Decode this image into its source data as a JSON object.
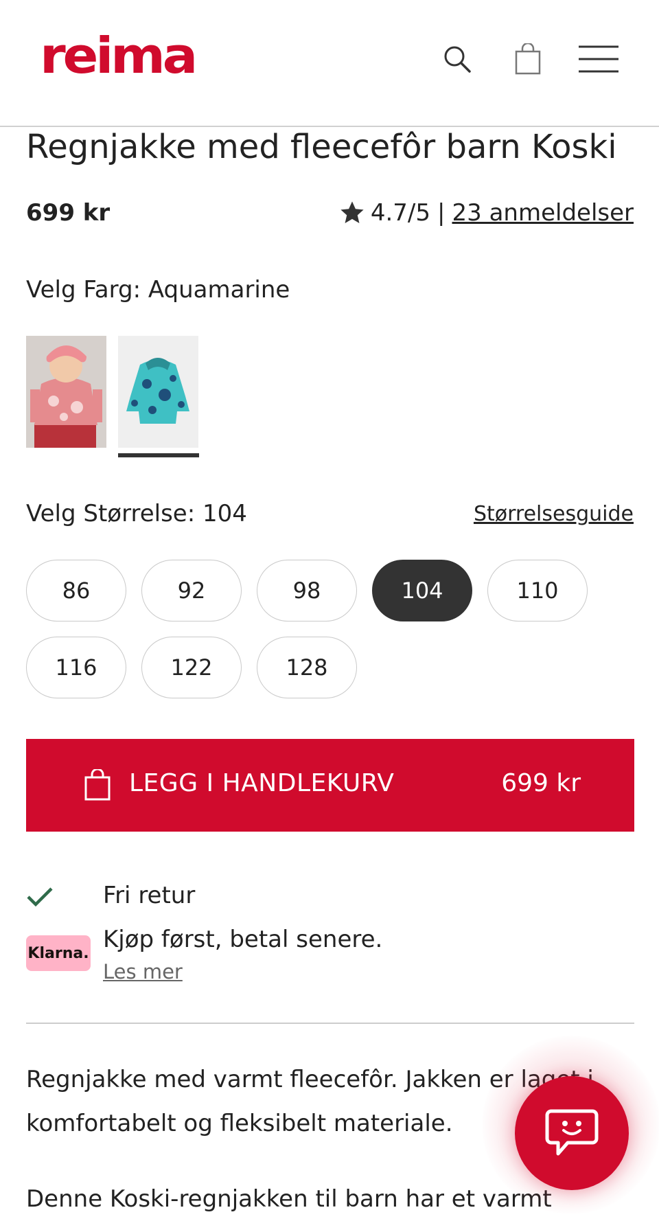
{
  "brand": {
    "name": "reima",
    "color": "#d00b2d"
  },
  "header": {
    "icons": [
      "search-icon",
      "shopping-bag-icon",
      "menu-icon"
    ]
  },
  "product": {
    "title": "Regnjakke med fleecefôr barn Koski",
    "price": "699 kr",
    "rating": "4.7/5",
    "rating_separator": "|",
    "reviews_link": "23 anmeldelser"
  },
  "color": {
    "label": "Velg Farg: Aquamarine",
    "swatches": [
      {
        "name": "pink",
        "selected": false
      },
      {
        "name": "Aquamarine",
        "selected": true
      }
    ]
  },
  "size": {
    "label": "Velg Størrelse: 104",
    "guide_link": "Størrelsesguide",
    "options": [
      "86",
      "92",
      "98",
      "104",
      "110",
      "116",
      "122",
      "128"
    ],
    "selected": "104"
  },
  "cart_button": {
    "label": "LEGG I HANDLEKURV",
    "price": "699 kr"
  },
  "benefits": {
    "return_text": "Fri retur",
    "klarna_logo": "Klarna.",
    "klarna_text": "Kjøp først, betal senere.",
    "klarna_link": "Les mer"
  },
  "description": {
    "para1_line1": "Regnjakke med varmt fleecefôr. Jakken er laget i",
    "para1_line2": "komfortabelt og fleksibelt materiale.",
    "para2_line1": "Denne Koski-regnjakken til barn har et varmt"
  },
  "chat": {
    "icon": "chat-smile-icon"
  }
}
